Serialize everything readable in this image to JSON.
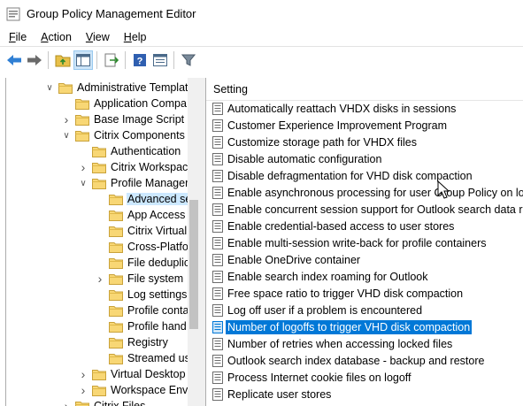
{
  "window": {
    "title": "Group Policy Management Editor"
  },
  "menu": [
    {
      "label": "File",
      "accel": "F",
      "rest": "ile"
    },
    {
      "label": "Action",
      "accel": "A",
      "rest": "ction"
    },
    {
      "label": "View",
      "accel": "V",
      "rest": "iew"
    },
    {
      "label": "Help",
      "accel": "H",
      "rest": "elp"
    }
  ],
  "toolbar": {
    "icons": [
      "back-arrow-icon",
      "forward-arrow-icon",
      "up-folder-icon",
      "show-hide-tree-icon",
      "export-list-icon",
      "help-icon",
      "properties-icon",
      "filter-icon"
    ]
  },
  "tree": {
    "items": [
      {
        "label": "Administrative Templat",
        "expander": "open"
      },
      {
        "label": "Application Compa",
        "expander": "none"
      },
      {
        "label": "Base Image Script F",
        "expander": "closed"
      },
      {
        "label": "Citrix Components",
        "expander": "open"
      },
      {
        "label": "Authentication",
        "expander": "none"
      },
      {
        "label": "Citrix Workspace",
        "expander": "closed"
      },
      {
        "label": "Profile Managem",
        "expander": "open"
      },
      {
        "label": "Advanced se",
        "expander": "none",
        "selected": true
      },
      {
        "label": "App Access",
        "expander": "none"
      },
      {
        "label": "Citrix Virtual",
        "expander": "none"
      },
      {
        "label": "Cross-Platfo",
        "expander": "none"
      },
      {
        "label": "File deduplic",
        "expander": "none"
      },
      {
        "label": "File system",
        "expander": "closed"
      },
      {
        "label": "Log settings",
        "expander": "none"
      },
      {
        "label": "Profile conta",
        "expander": "none"
      },
      {
        "label": "Profile hand",
        "expander": "none"
      },
      {
        "label": "Registry",
        "expander": "none"
      },
      {
        "label": "Streamed us",
        "expander": "none"
      },
      {
        "label": "Virtual Desktop",
        "expander": "closed"
      },
      {
        "label": "Workspace Envi",
        "expander": "closed"
      },
      {
        "label": "Citrix Files",
        "expander": "closed"
      }
    ]
  },
  "settings": {
    "column_header": "Setting",
    "items": [
      {
        "label": "Automatically reattach VHDX disks in sessions"
      },
      {
        "label": "Customer Experience Improvement Program"
      },
      {
        "label": "Customize storage path for VHDX files"
      },
      {
        "label": "Disable automatic configuration"
      },
      {
        "label": "Disable defragmentation for VHD disk compaction"
      },
      {
        "label": "Enable asynchronous processing for user Group Policy on lo..."
      },
      {
        "label": "Enable concurrent session support for Outlook search data r..."
      },
      {
        "label": "Enable credential-based access to user stores"
      },
      {
        "label": "Enable multi-session write-back for profile containers"
      },
      {
        "label": "Enable OneDrive container"
      },
      {
        "label": "Enable search index roaming for Outlook"
      },
      {
        "label": "Free space ratio to trigger VHD disk compaction"
      },
      {
        "label": "Log off user if a problem is encountered"
      },
      {
        "label": "Number of logoffs to trigger VHD disk compaction",
        "selected": true
      },
      {
        "label": "Number of retries when accessing locked files"
      },
      {
        "label": "Outlook search index database - backup and restore"
      },
      {
        "label": "Process Internet cookie files on logoff"
      },
      {
        "label": "Replicate user stores"
      }
    ]
  },
  "colors": {
    "selection_blue": "#0078d7",
    "tree_selection": "#cce8ff",
    "folder_yellow": "#f8d775"
  }
}
